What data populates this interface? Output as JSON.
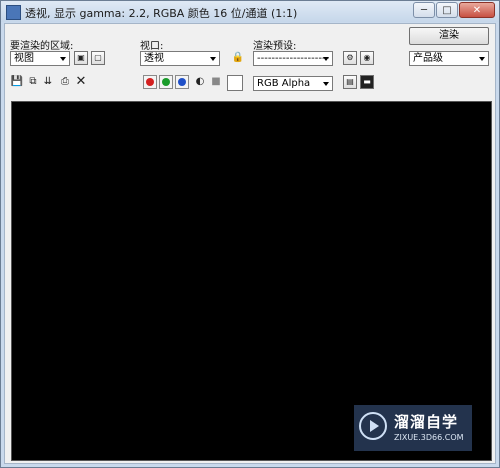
{
  "window": {
    "title": "透视, 显示 gamma: 2.2, RGBA 颜色 16 位/通道 (1:1)"
  },
  "titlebar_buttons": {
    "minimize": "─",
    "maximize": "□",
    "close": "✕"
  },
  "area_to_render": {
    "label": "要渲染的区域:",
    "value": "视图"
  },
  "viewport": {
    "label": "视口:",
    "value": "透视"
  },
  "render_preset": {
    "label": "渲染预设:",
    "value": "--------------------"
  },
  "render_button": "渲染",
  "production": {
    "value": "产品级"
  },
  "channel": {
    "value": "RGB Alpha"
  },
  "colors": {
    "red": "#d42020",
    "green": "#1a9c2a",
    "blue": "#2050c8",
    "frame": "#000000"
  },
  "icons": [
    "save-icon",
    "copy-icon",
    "clone-icon",
    "print-icon",
    "clear-icon",
    "lock-icon",
    "render-setup-icon",
    "environment-icon",
    "alpha-icon",
    "mono-icon",
    "display-icon",
    "display-toggle-icon"
  ],
  "watermark": {
    "name": "溜溜自学",
    "url": "ZIXUE.3D66.COM"
  }
}
